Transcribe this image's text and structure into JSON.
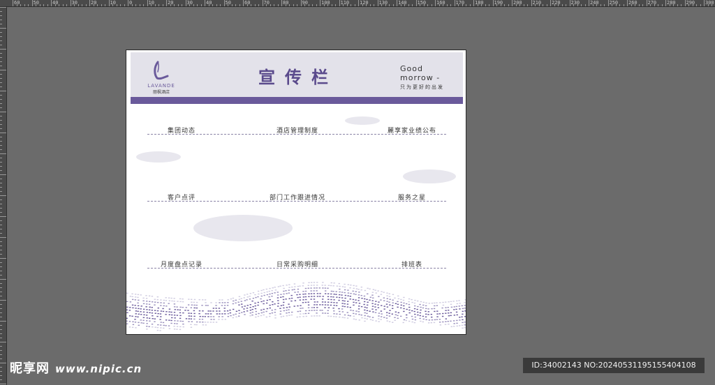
{
  "ruler": {
    "ticks": [
      "60",
      "50",
      "40",
      "30",
      "20",
      "10",
      "0",
      "10",
      "20",
      "30",
      "40",
      "50",
      "60",
      "70",
      "80",
      "90",
      "100",
      "110",
      "120",
      "130",
      "140",
      "150",
      "160",
      "170",
      "180",
      "190",
      "200",
      "210",
      "220",
      "230",
      "240",
      "250",
      "260",
      "270",
      "280",
      "290",
      "300"
    ]
  },
  "board": {
    "logo_name": "LAVANDE",
    "logo_sub": "丽枫酒店",
    "title": "宣传栏",
    "slogan_en": "Good morrow -",
    "slogan_cn": "只为更好的出发",
    "accent": "#6a5a9b",
    "categories": [
      "集团动态",
      "酒店管理制度",
      "麗享家业绩公布",
      "客户点评",
      "部门工作跟进情况",
      "服务之星",
      "月度盘点记录",
      "日常采购明细",
      "排班表"
    ]
  },
  "watermark": {
    "site_name": "昵享网",
    "site_url": "www.nipic.cn",
    "image_id": "ID:34002143 NO:20240531195155404108"
  }
}
